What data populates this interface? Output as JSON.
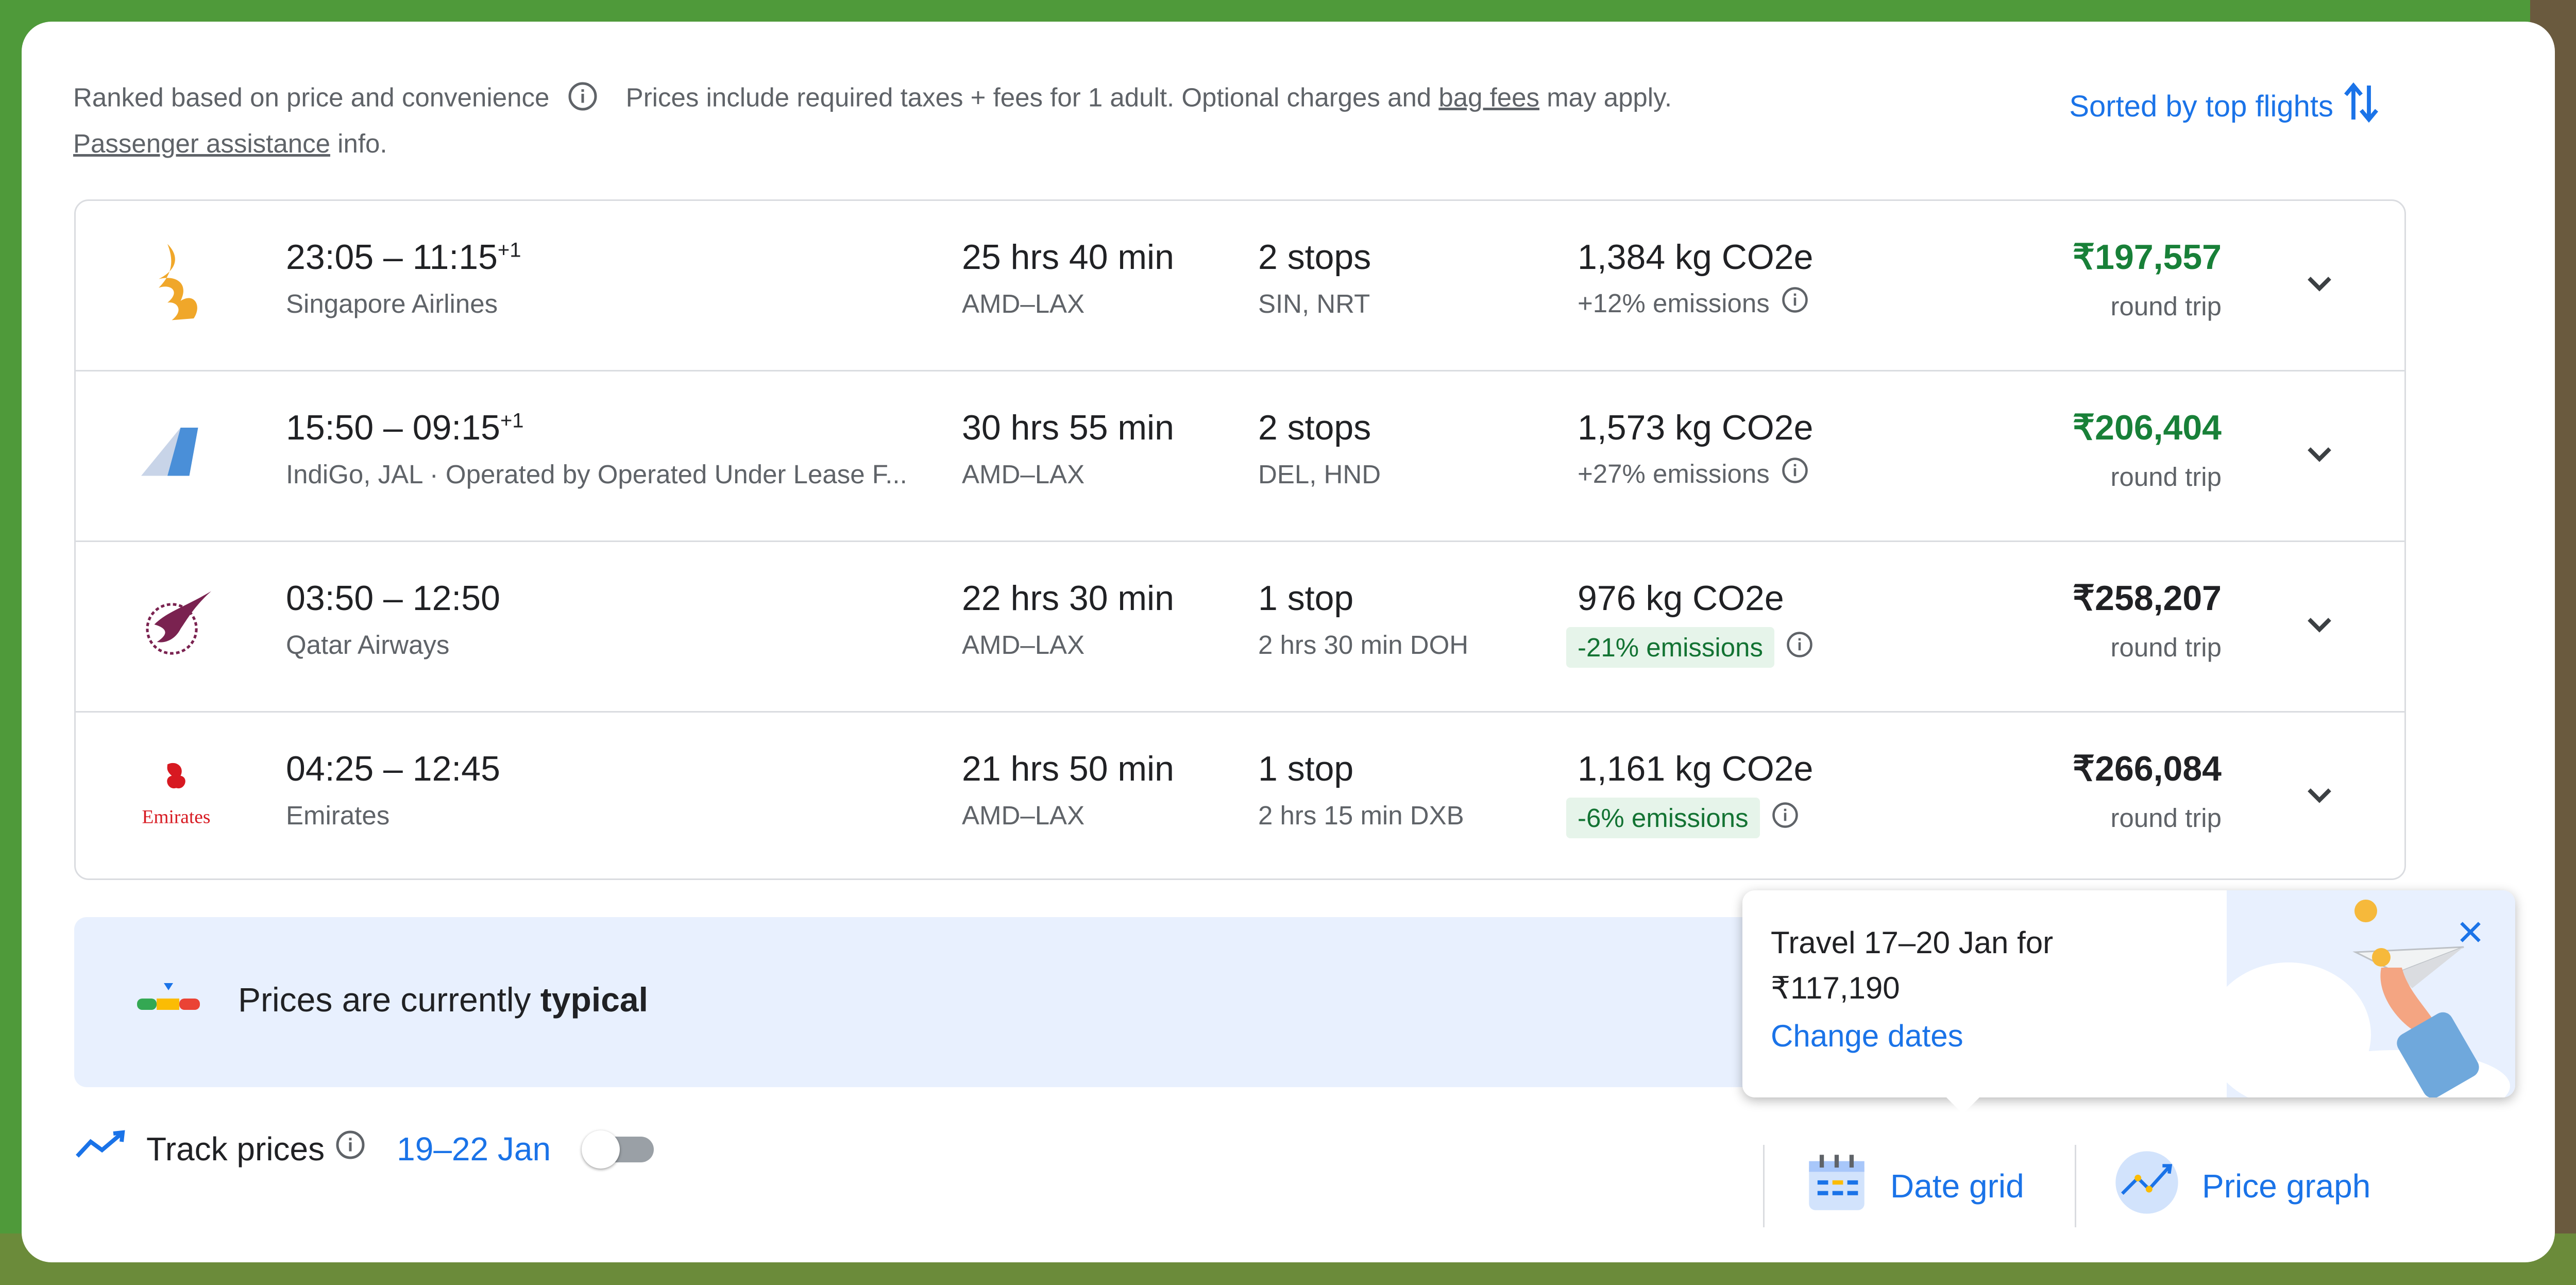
{
  "header": {
    "ranking_text": "Ranked based on price and convenience",
    "taxes_text": "Prices include required taxes + fees for 1 adult. Optional charges and",
    "bag_fees_link": "bag fees",
    "may_apply": "may apply.",
    "passenger_link": "Passenger assistance",
    "info_suffix": "info.",
    "sort_label": "Sorted by top flights"
  },
  "flights": [
    {
      "times": "23:05 – 11:15",
      "plus_day": "+1",
      "airline": "Singapore Airlines",
      "duration": "25 hrs 40 min",
      "route": "AMD–LAX",
      "stops": "2 stops",
      "stop_detail": "SIN, NRT",
      "co2": "1,384 kg CO2e",
      "emissions": "+12% emissions",
      "price": "₹197,557",
      "trip": "round trip",
      "logo": "singapore-airlines-logo"
    },
    {
      "times": "15:50 – 09:15",
      "plus_day": "+1",
      "airline": "IndiGo, JAL · Operated by Operated Under Lease F...",
      "duration": "30 hrs 55 min",
      "route": "AMD–LAX",
      "stops": "2 stops",
      "stop_detail": "DEL, HND",
      "co2": "1,573 kg CO2e",
      "emissions": "+27% emissions",
      "price": "₹206,404",
      "trip": "round trip",
      "logo": "multi-airline-logo"
    },
    {
      "times": "03:50 – 12:50",
      "plus_day": "",
      "airline": "Qatar Airways",
      "duration": "22 hrs 30 min",
      "route": "AMD–LAX",
      "stops": "1 stop",
      "stop_detail": "2 hrs 30 min DOH",
      "co2": "976 kg CO2e",
      "emissions": "-21% emissions",
      "price": "₹258,207",
      "trip": "round trip",
      "logo": "qatar-airways-logo"
    },
    {
      "times": "04:25 – 12:45",
      "plus_day": "",
      "airline": "Emirates",
      "duration": "21 hrs 50 min",
      "route": "AMD–LAX",
      "stops": "1 stop",
      "stop_detail": "2 hrs 15 min DXB",
      "co2": "1,161 kg CO2e",
      "emissions": "-6% emissions",
      "price": "₹266,084",
      "trip": "round trip",
      "logo": "emirates-logo",
      "logo_text": "Emirates"
    }
  ],
  "price_insight": {
    "prefix": "Prices are currently",
    "level": "typical"
  },
  "track": {
    "label": "Track prices",
    "dates": "19–22 Jan"
  },
  "popup": {
    "line1": "Travel 17–20 Jan for",
    "line2": "₹117,190",
    "link": "Change dates"
  },
  "tools": {
    "date_grid": "Date grid",
    "price_graph": "Price graph"
  },
  "colors": {
    "accent": "#1a73e8",
    "price_green": "#188038",
    "badge_green_bg": "#e6f4ea"
  }
}
